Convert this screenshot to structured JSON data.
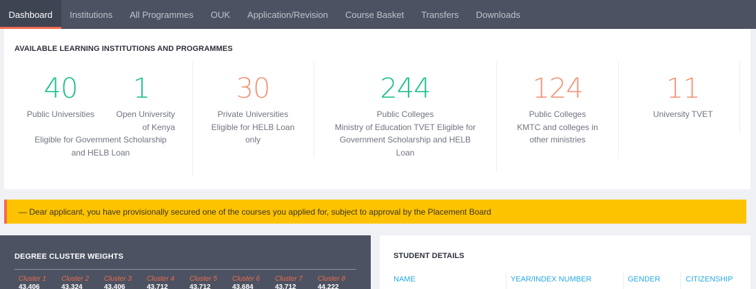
{
  "nav": {
    "tabs": [
      {
        "label": "Dashboard",
        "active": true
      },
      {
        "label": "Institutions"
      },
      {
        "label": "All Programmes"
      },
      {
        "label": "OUK"
      },
      {
        "label": "Application/Revision"
      },
      {
        "label": "Course Basket"
      },
      {
        "label": "Transfers"
      },
      {
        "label": "Downloads"
      }
    ]
  },
  "institutions": {
    "title": "AVAILABLE LEARNING INSTITUTIONS AND PROGRAMMES",
    "public_universities": {
      "count": "40",
      "label": "Public Universities"
    },
    "open_university": {
      "count": "1",
      "label_line1": "Open University",
      "label_line2": "of Kenya"
    },
    "public_note_line1": "Eligible for Government Scholarship",
    "public_note_line2": "and HELB Loan",
    "private_universities": {
      "count": "30",
      "line1": "Private Universities",
      "line2": "Eligible for HELB Loan",
      "line3": "only"
    },
    "public_colleges_moe": {
      "count": "244",
      "line1": "Public Colleges",
      "line2": "Ministry of Education TVET Eligible for",
      "line3": "Government Scholarship and HELB",
      "line4": "Loan"
    },
    "public_colleges_kmtc": {
      "count": "124",
      "line1": "Public Colleges",
      "line2": "KMTC and colleges in",
      "line3": "other ministries"
    },
    "university_tvet": {
      "count": "11",
      "line1": "University TVET"
    }
  },
  "alert": {
    "text": "— Dear applicant, you have provisionally secured one of the courses you applied for, subject to approval by the Placement Board"
  },
  "clusters": {
    "title": "DEGREE CLUSTER WEIGHTS",
    "items": [
      {
        "name": "Cluster 1",
        "value": "43.406"
      },
      {
        "name": "Cluster 2",
        "value": "43.324"
      },
      {
        "name": "Cluster 3",
        "value": "43.406"
      },
      {
        "name": "Cluster 4",
        "value": "43.712"
      },
      {
        "name": "Cluster 5",
        "value": "43.712"
      },
      {
        "name": "Cluster 6",
        "value": "43.684"
      },
      {
        "name": "Cluster 7",
        "value": "43.712"
      },
      {
        "name": "Cluster 8",
        "value": "44.222"
      }
    ]
  },
  "student": {
    "title": "STUDENT DETAILS",
    "columns": [
      "NAME",
      "YEAR/INDEX NUMBER",
      "GENDER",
      "CITIZENSHIP"
    ]
  },
  "colors": {
    "nav_bg": "#4c5261",
    "accent_orange": "#f26b4f",
    "teal": "#1ebf92",
    "salmon": "#f2967a",
    "alert_yellow": "#fdc300",
    "link_blue": "#28a9e2"
  }
}
